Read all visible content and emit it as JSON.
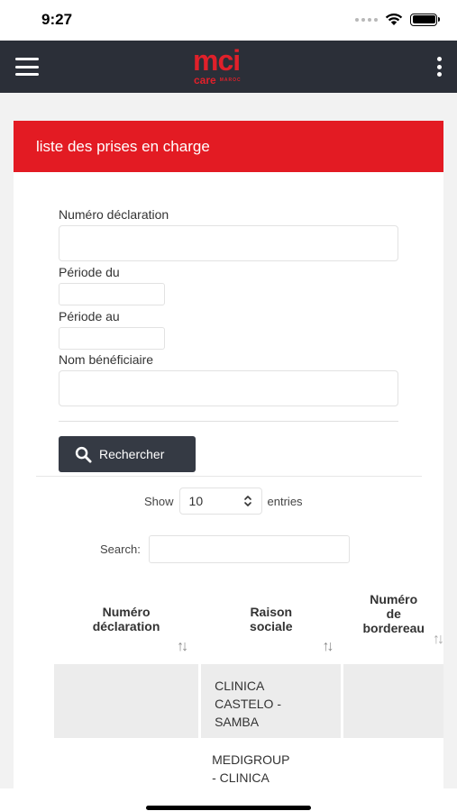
{
  "status_bar": {
    "time": "9:27"
  },
  "navbar": {
    "logo_main": "mci",
    "logo_sub": "care",
    "logo_country": "MAROC"
  },
  "card": {
    "title": "liste des prises en charge"
  },
  "form": {
    "numero_label": "Numéro déclaration",
    "periode_du_label": "Période du",
    "periode_au_label": "Période au",
    "nom_label": "Nom bénéficiaire",
    "search_button": "Rechercher"
  },
  "datatable": {
    "show_label": "Show",
    "entries_value": "10",
    "entries_label": "entries",
    "search_label": "Search:",
    "columns": [
      {
        "line1": "Numéro",
        "line2": "déclaration",
        "line3": ""
      },
      {
        "line1": "Raison",
        "line2": "sociale",
        "line3": ""
      },
      {
        "line1": "Numéro",
        "line2": "de",
        "line3": "bordereau"
      }
    ],
    "rows": [
      {
        "numero": "",
        "raison_l1": "CLINICA",
        "raison_l2": "CASTELO -",
        "raison_l3": "SAMBA",
        "bordereau": ""
      },
      {
        "numero": "",
        "raison_l1": "MEDIGROUP",
        "raison_l2": "- CLINICA",
        "raison_l3": "",
        "bordereau": ""
      }
    ]
  }
}
